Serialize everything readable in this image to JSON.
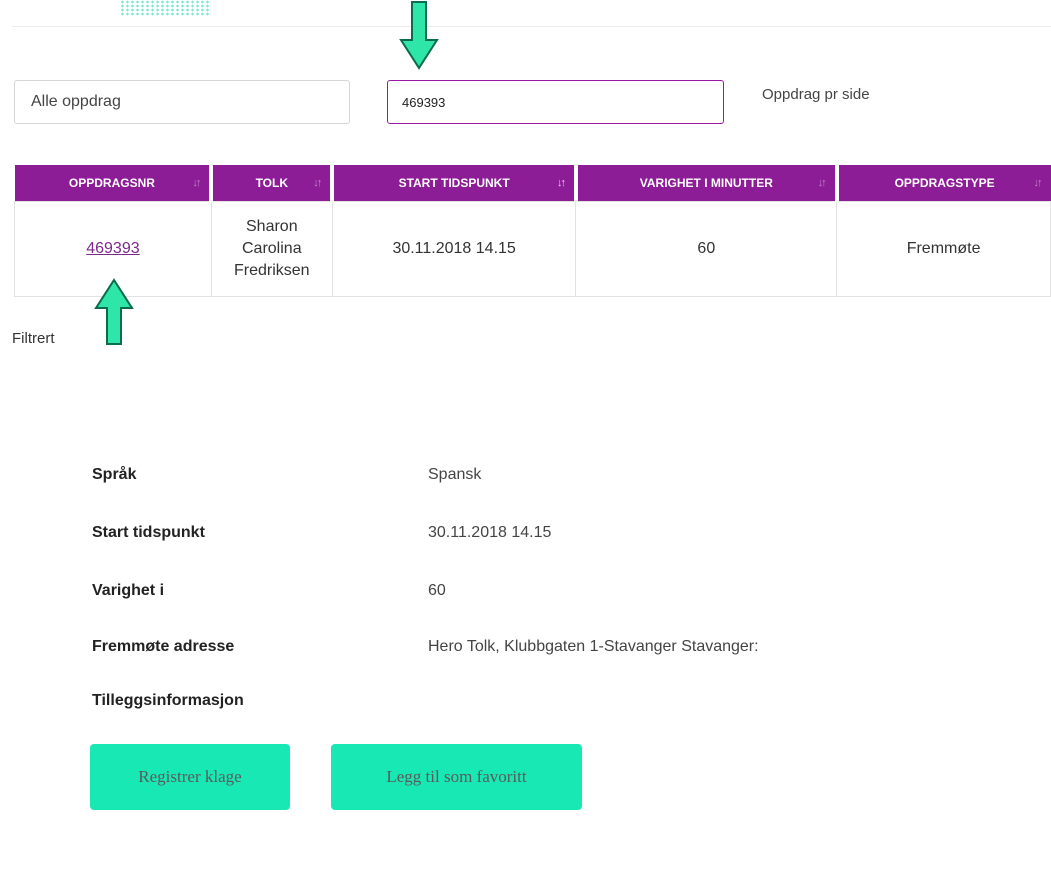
{
  "filter": {
    "scope_value": "Alle oppdrag",
    "search_value": "469393",
    "per_page_label": "Oppdrag pr side"
  },
  "table": {
    "columns": [
      "OPPDRAGSNR",
      "TOLK",
      "START TIDSPUNKT",
      "VARIGHET I MINUTTER",
      "OPPDRAGSTYPE"
    ],
    "rows": [
      {
        "oppdragsnr": "469393",
        "tolk_lines": [
          "Sharon",
          "Carolina",
          "Fredriksen"
        ],
        "start": "30.11.2018 14.15",
        "varighet": "60",
        "type": "Fremmøte"
      }
    ]
  },
  "status": {
    "filtered_label": "Filtrert"
  },
  "details": [
    {
      "label": "Språk",
      "value": "Spansk"
    },
    {
      "label": "Start tidspunkt",
      "value": "30.11.2018 14.15"
    },
    {
      "label": "Varighet i",
      "value": "60"
    },
    {
      "label": "Fremmøte adresse",
      "value": "Hero Tolk, Klubbgaten 1-Stavanger Stavanger:"
    },
    {
      "label": "Tilleggsinformasjon",
      "value": ""
    }
  ],
  "actions": {
    "complaint_label": "Registrer klage",
    "favorite_label": "Legg til som favoritt"
  },
  "colors": {
    "header_purple": "#8c1d97",
    "accent_mint": "#17e8b4",
    "arrow_fill": "#2ee6a8",
    "arrow_outline": "#0a6b4e"
  }
}
